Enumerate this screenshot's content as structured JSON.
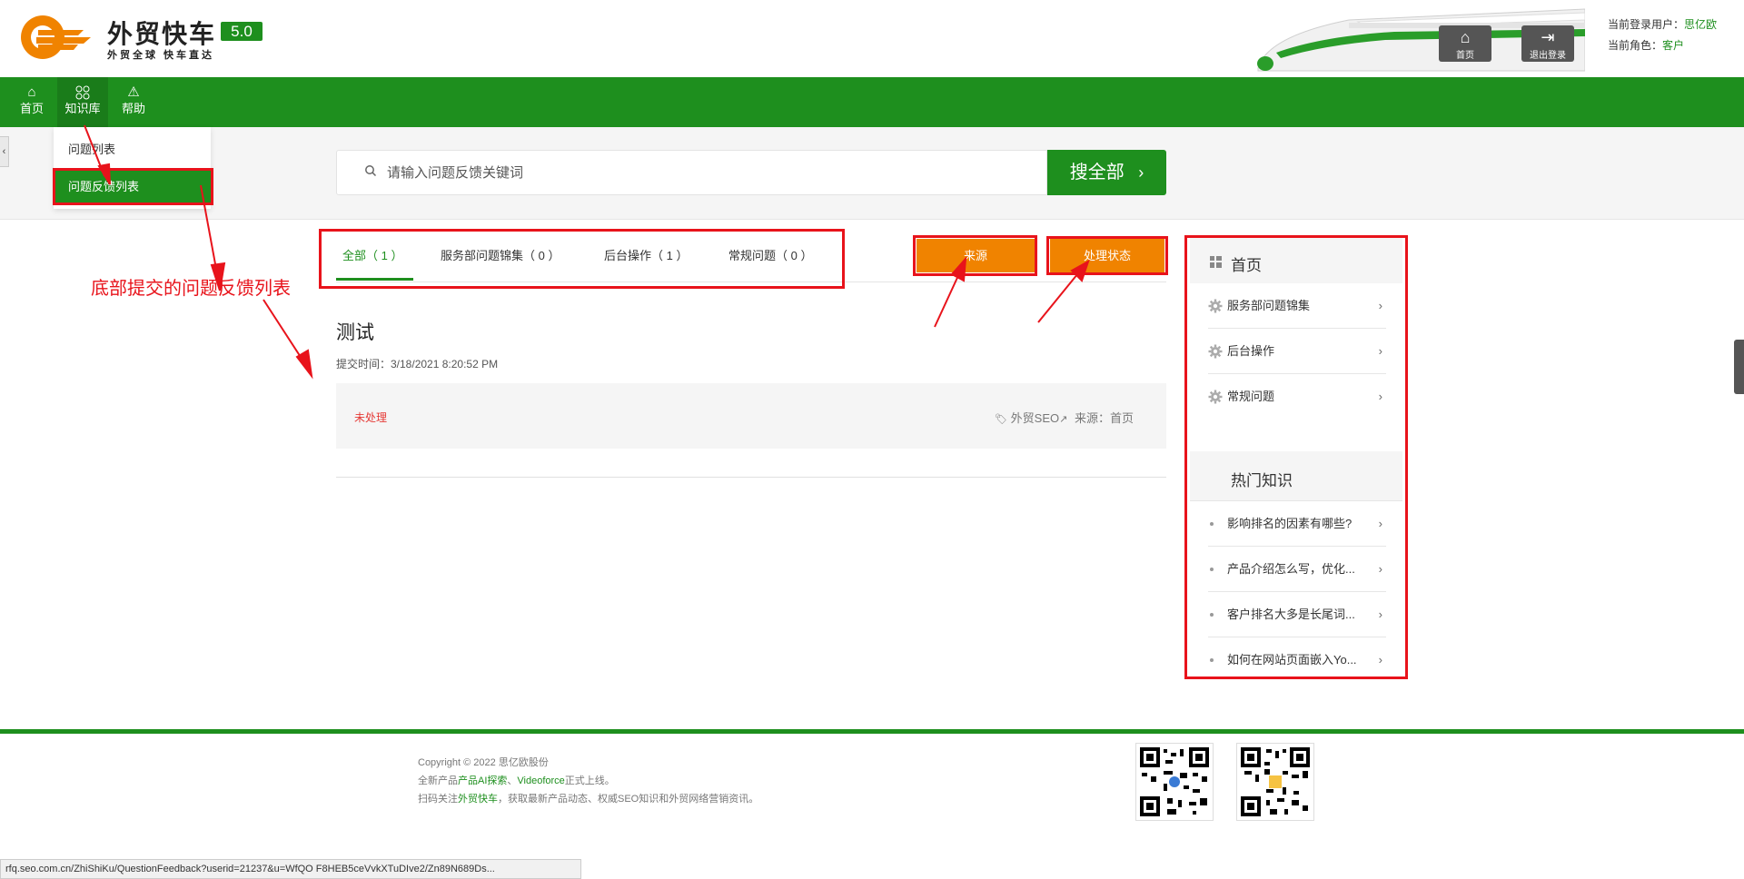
{
  "header": {
    "brand_title": "外贸快车",
    "brand_version": "5.0",
    "brand_slogan": "外贸全球 快车直达",
    "home_button": "首页",
    "logout_button": "退出登录",
    "user_label": "当前登录用户：",
    "user_value": "思亿欧",
    "role_label": "当前角色：",
    "role_value": "客户"
  },
  "nav": {
    "items": [
      {
        "label": "首页",
        "icon": "home-icon"
      },
      {
        "label": "知识库",
        "icon": "grid-circles-icon"
      },
      {
        "label": "帮助",
        "icon": "warning-icon"
      }
    ]
  },
  "dropdown": {
    "items": [
      {
        "label": "问题列表"
      },
      {
        "label": "问题反馈列表"
      }
    ]
  },
  "search": {
    "placeholder": "请输入问题反馈关键词",
    "button": "搜全部"
  },
  "tabs": [
    {
      "label": "全部（ 1 ）"
    },
    {
      "label": "服务部问题锦集（ 0 ）"
    },
    {
      "label": "后台操作（ 1 ）"
    },
    {
      "label": "常规问题（ 0 ）"
    }
  ],
  "filters": {
    "source": "来源",
    "status": "处理状态"
  },
  "feedback": {
    "title": "测试",
    "time": "提交时间：3/18/2021 8:20:52 PM",
    "status": "未处理",
    "tag": "外贸SEO",
    "source": "来源：首页"
  },
  "sidebar": {
    "head": "首页",
    "categories": [
      {
        "label": "服务部问题锦集"
      },
      {
        "label": "后台操作"
      },
      {
        "label": "常规问题"
      }
    ],
    "hot_head": "热门知识",
    "hot": [
      {
        "label": "影响排名的因素有哪些?"
      },
      {
        "label": "产品介绍怎么写，优化..."
      },
      {
        "label": "客户排名大多是长尾词..."
      },
      {
        "label": "如何在网站页面嵌入Yo..."
      }
    ]
  },
  "footer": {
    "copyright": "Copyright © 2022 思亿欧股份",
    "line2_a": "全新产品",
    "line2_b": "产品AI探索",
    "line2_c": "、",
    "line2_d": "Videoforce",
    "line2_e": "正式上线。",
    "line3_a": "扫码关注",
    "line3_b": "外贸快车",
    "line3_c": "，获取最新产品动态、权威SEO知识和外贸网络营销资讯。"
  },
  "statusbar": {
    "url": "rfq.seo.com.cn/ZhiShiKu/QuestionFeedback?userid=21237&u=WfQO F8HEB5ceVvkXTuDIve2/Zn89N689Ds..."
  },
  "annotation": {
    "text": "底部提交的问题反馈列表"
  },
  "colors": {
    "brand_green": "#1e8f1e",
    "orange": "#f08300",
    "annotation_red": "#e8131b",
    "status_red": "#e53935"
  }
}
